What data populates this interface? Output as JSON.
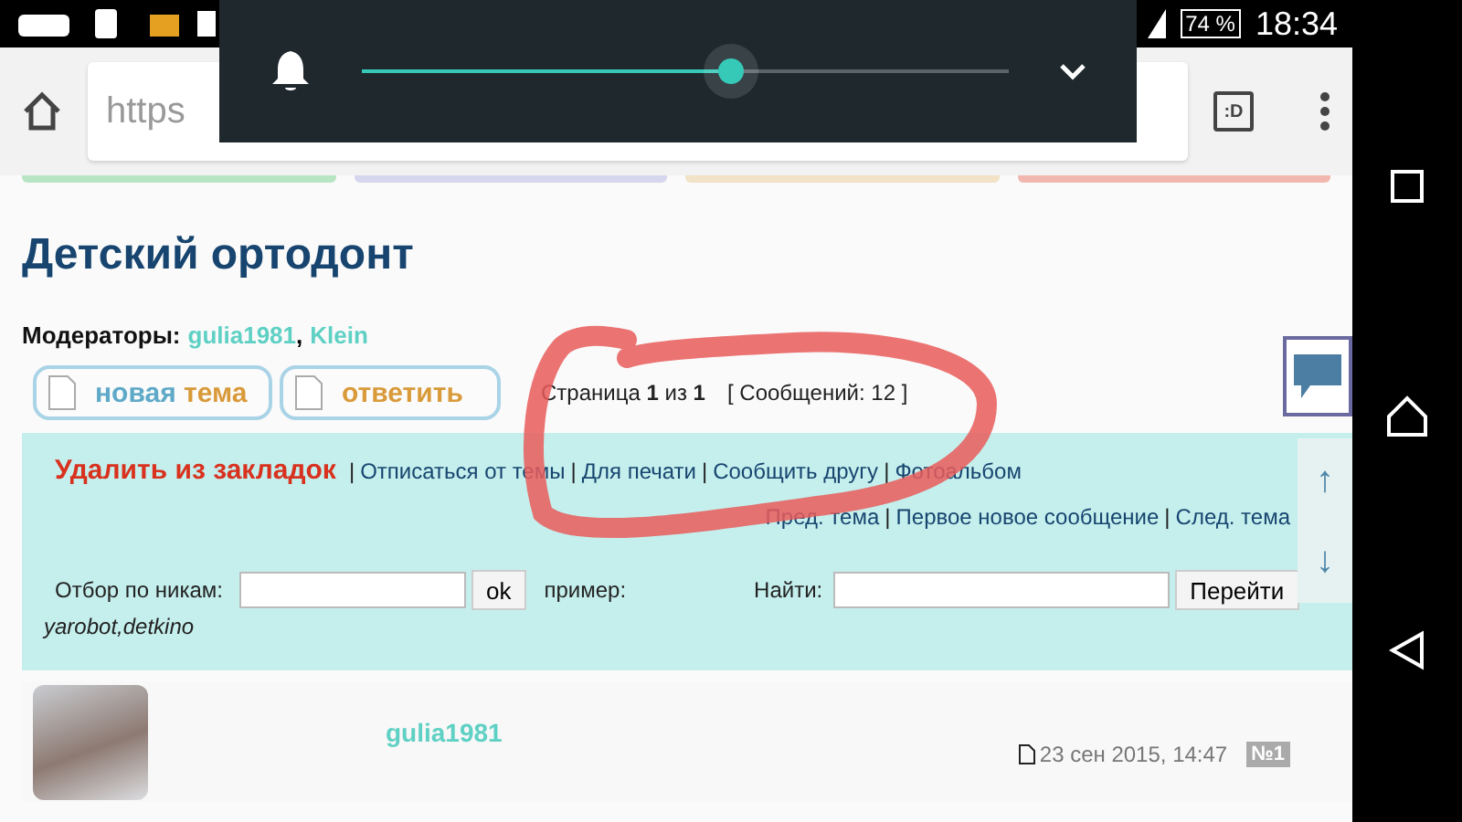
{
  "status_bar": {
    "battery": "74 %",
    "time": "18:34"
  },
  "browser": {
    "url": "https",
    "tabs_button": ":D"
  },
  "volume_panel": {
    "level": 0.57
  },
  "page": {
    "title": "Детский ортодонт",
    "moderators_label": "Модераторы:",
    "moderators": [
      {
        "name": "gulia1981",
        "separator": ","
      },
      {
        "name": "Klein"
      }
    ],
    "buttons": [
      {
        "parts": [
          "новая",
          "тема"
        ]
      },
      {
        "parts": [
          "ответить"
        ]
      }
    ],
    "pagination": "Страница **1** из **1**",
    "count": "[ Сообщений: 12 ]",
    "bookmark": "Удалить из закладок",
    "links": [
      {
        "separator": "|",
        "label": "Отписаться от темы"
      },
      {
        "separator": "|",
        "label": "Для печати"
      },
      {
        "separator": "|",
        "label": "Сообщить другу"
      },
      {
        "separator": "|",
        "label": "Фотоальбом"
      }
    ],
    "nav_links": [
      {
        "label": "Пред. тема"
      },
      {
        "separator": "|",
        "label": "Первое новое сообщение"
      },
      {
        "separator": "|",
        "label": "След. тема"
      }
    ],
    "filter": {
      "label": "Отбор по никам:",
      "button": "ok",
      "example_label": "пример:",
      "example": "yarobot,detkino"
    },
    "search": {
      "label": "Найти:",
      "button": "Перейти"
    },
    "scroll_buttons": [
      "↑",
      "↓"
    ],
    "post": {
      "author": "gulia1981",
      "date": "23 сен 2015, 14:47",
      "number": "№1"
    }
  }
}
